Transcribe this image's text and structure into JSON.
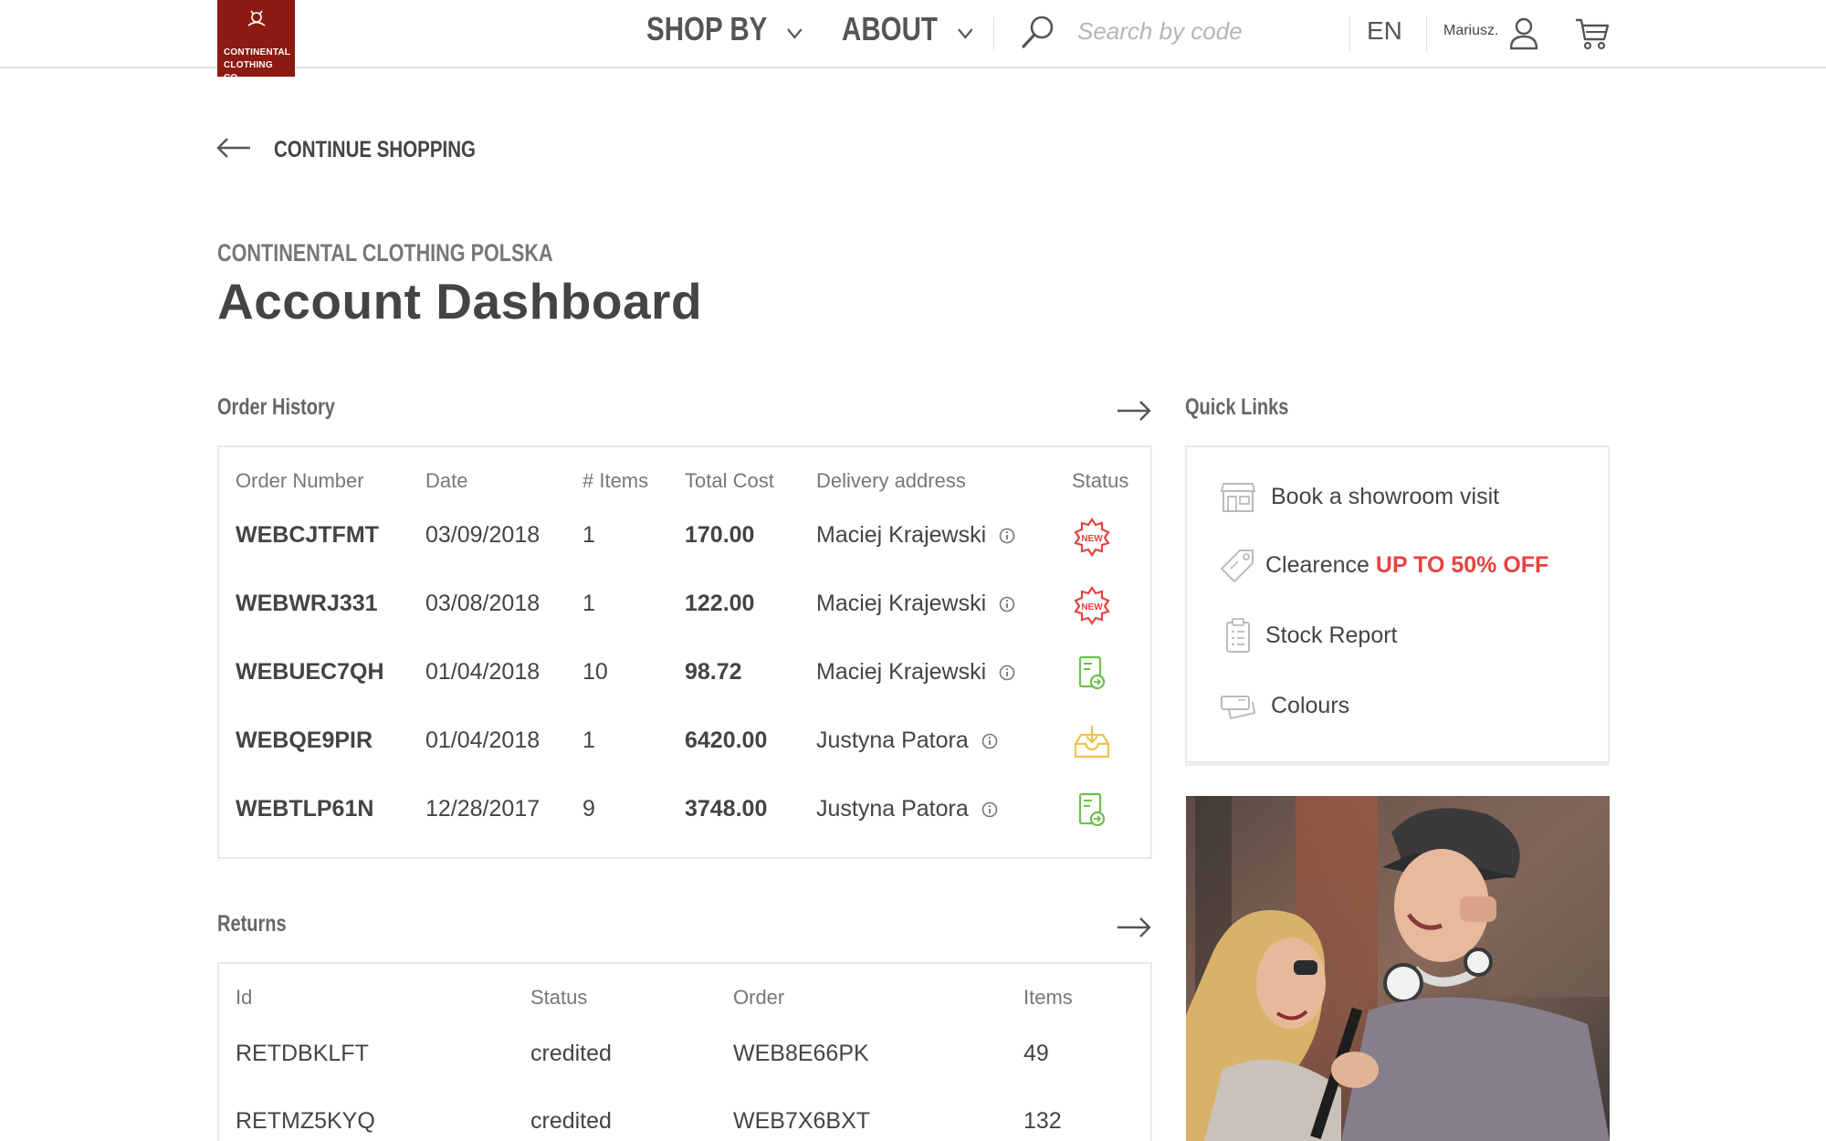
{
  "header": {
    "logo_text_line1": "CONTINENTAL",
    "logo_text_line2": "CLOTHING CO.",
    "nav": [
      {
        "label": "SHOP BY"
      },
      {
        "label": "ABOUT"
      }
    ],
    "search_placeholder": "Search by code",
    "language": "EN",
    "user_name": "Mariusz."
  },
  "back_link": {
    "label": "CONTINUE SHOPPING"
  },
  "company_name": "CONTINENTAL CLOTHING POLSKA",
  "page_title": "Account Dashboard",
  "order_history": {
    "title": "Order History",
    "columns": [
      "Order Number",
      "Date",
      "# Items",
      "Total Cost",
      "Delivery address",
      "Status"
    ],
    "rows": [
      {
        "number": "WEBCJTFMT",
        "date": "03/09/2018",
        "items": "1",
        "cost": "170.00",
        "address": "Maciej Krajewski",
        "status_icon": "new-badge-icon"
      },
      {
        "number": "WEBWRJ331",
        "date": "03/08/2018",
        "items": "1",
        "cost": "122.00",
        "address": "Maciej Krajewski",
        "status_icon": "new-badge-icon"
      },
      {
        "number": "WEBUEC7QH",
        "date": "01/04/2018",
        "items": "10",
        "cost": "98.72",
        "address": "Maciej Krajewski",
        "status_icon": "invoice-sent-icon"
      },
      {
        "number": "WEBQE9PIR",
        "date": "01/04/2018",
        "items": "1",
        "cost": "6420.00",
        "address": "Justyna Patora",
        "status_icon": "inbox-download-icon"
      },
      {
        "number": "WEBTLP61N",
        "date": "12/28/2017",
        "items": "9",
        "cost": "3748.00",
        "address": "Justyna Patora",
        "status_icon": "invoice-sent-icon"
      }
    ]
  },
  "returns": {
    "title": "Returns",
    "columns": [
      "Id",
      "Status",
      "Order",
      "Items"
    ],
    "rows": [
      {
        "id": "RETDBKLFT",
        "status": "credited",
        "order": "WEB8E66PK",
        "items": "49"
      },
      {
        "id": "RETMZ5KYQ",
        "status": "credited",
        "order": "WEB7X6BXT",
        "items": "132"
      }
    ]
  },
  "quick_links": {
    "title": "Quick Links",
    "items": [
      {
        "icon": "showroom-icon",
        "label": "Book a showroom visit",
        "promo": ""
      },
      {
        "icon": "price-tag-icon",
        "label": "Clearence ",
        "promo": "UP TO 50% OFF"
      },
      {
        "icon": "clipboard-icon",
        "label": "Stock Report",
        "promo": ""
      },
      {
        "icon": "swatches-icon",
        "label": "Colours",
        "promo": ""
      }
    ]
  },
  "colors": {
    "brand": "#8d1a12",
    "promo": "#e8423f",
    "status_new": "#e8423f",
    "status_invoice": "#6cc04a",
    "status_download": "#f2c14e"
  }
}
